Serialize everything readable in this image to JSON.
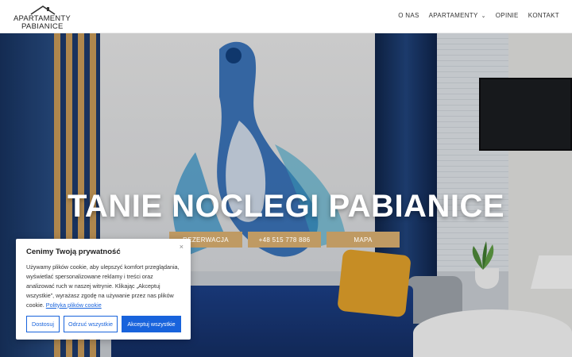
{
  "logo": {
    "line1": "APARTAMENTY",
    "line2": "PABIANICE"
  },
  "nav": {
    "items": [
      {
        "label": "O NAS"
      },
      {
        "label": "APARTAMENTY",
        "has_dropdown": true
      },
      {
        "label": "OPINIE"
      },
      {
        "label": "KONTAKT"
      }
    ]
  },
  "hero": {
    "title": "TANIE NOCLEGI PABIANICE",
    "buttons": [
      {
        "label": "REZERWACJA"
      },
      {
        "label": "+48 515 778 886"
      },
      {
        "label": "MAPA"
      }
    ],
    "button_color": "#bf9a63"
  },
  "cookie": {
    "title": "Cenimy Twoją prywatność",
    "text": "Używamy plików cookie, aby ulepszyć komfort przeglądania, wyświetlać spersonalizowane reklamy i treści oraz analizować ruch w naszej witrynie. Klikając „Akceptuj wszystkie”, wyrażasz zgodę na używanie przez nas plików cookie.",
    "link": "Polityka plików cookie",
    "close_icon": "×",
    "buttons": {
      "customize": "Dostosuj",
      "reject": "Odrzuć wszystkie",
      "accept": "Akceptuj wszystkie"
    },
    "accent_color": "#1863dc"
  }
}
